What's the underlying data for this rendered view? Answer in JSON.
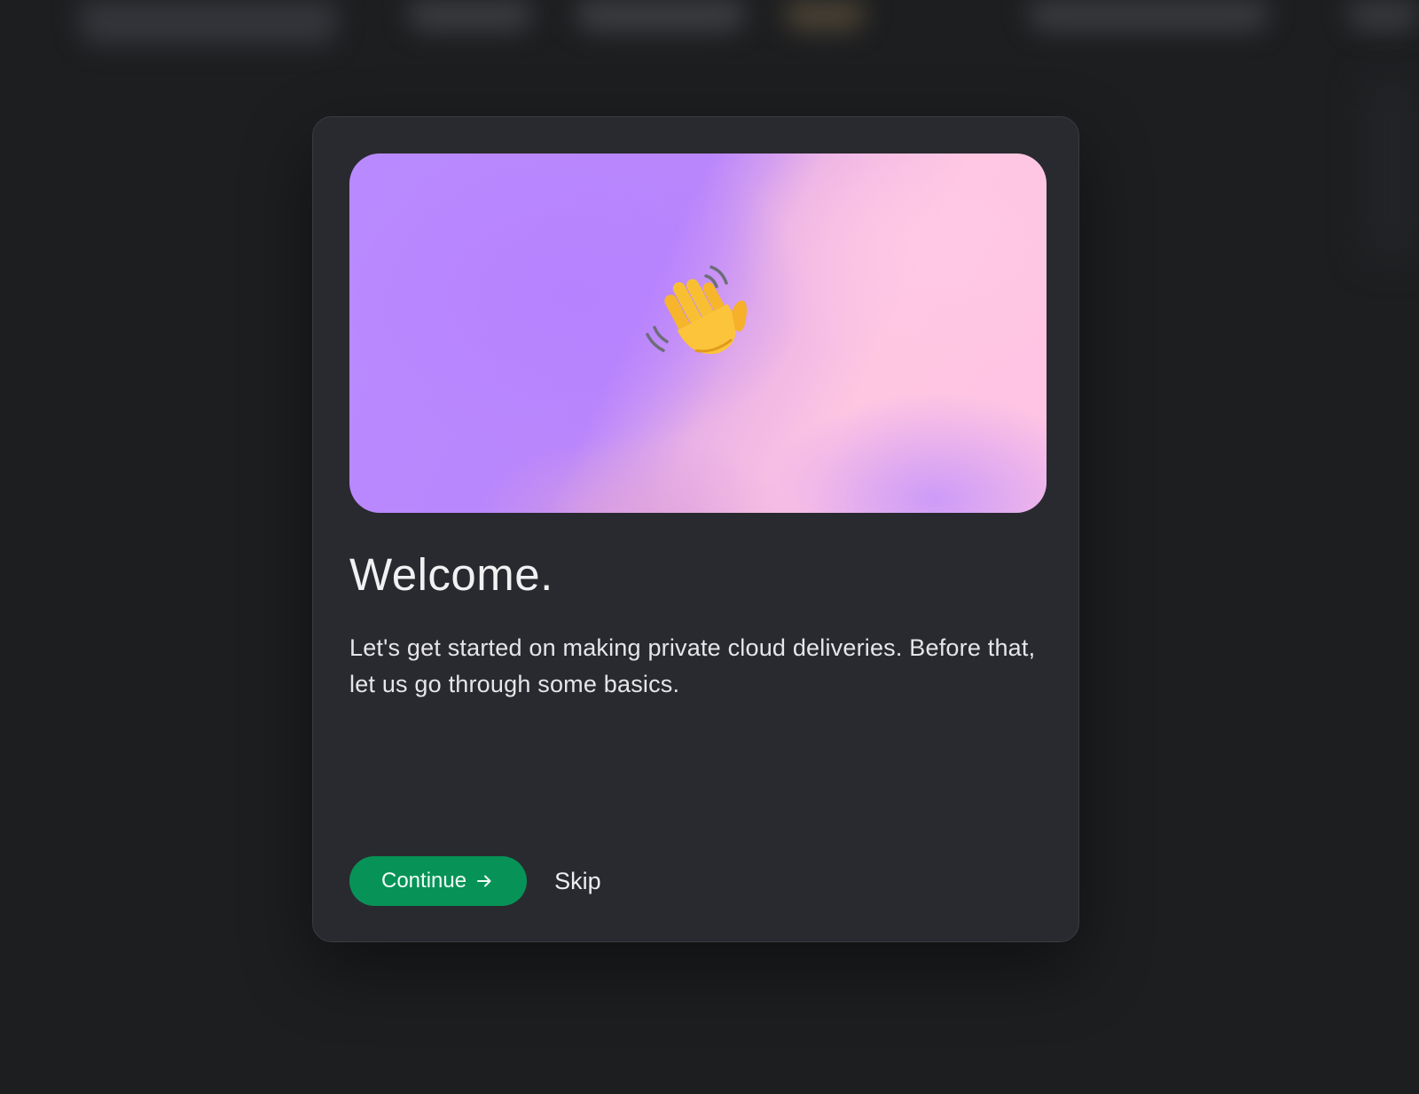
{
  "onboarding_modal": {
    "hero": {
      "icon": "waving-hand-icon"
    },
    "title": "Welcome.",
    "description": "Let's get started on making private cloud deliveries. Before that, let us go through some basics.",
    "actions": {
      "continue_label": "Continue",
      "continue_icon": "arrow-right-icon",
      "skip_label": "Skip"
    }
  },
  "colors": {
    "page_background": "#1d1e20",
    "modal_background": "#292a2f",
    "primary_button": "#079357",
    "hero_purple": "#b98aff",
    "hero_pink": "#ffc6e2"
  }
}
